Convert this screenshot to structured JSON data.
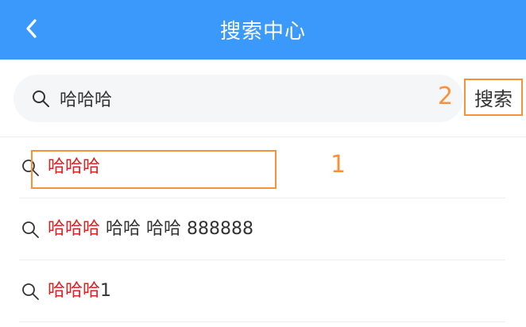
{
  "header": {
    "title": "搜索中心",
    "background_color": "#3a99fb",
    "back_icon": "chevron-left-icon"
  },
  "search": {
    "value": "哈哈哈",
    "icon": "search-icon",
    "button_label": "搜索"
  },
  "suggestions": [
    {
      "highlight": "哈哈哈",
      "rest": ""
    },
    {
      "highlight": "哈哈哈",
      "rest": " 哈哈 哈哈 888888"
    },
    {
      "highlight": "哈哈哈",
      "rest": "1"
    }
  ],
  "annotations": {
    "label_1": "1",
    "label_2": "2",
    "color": "#f7923a"
  },
  "colors": {
    "highlight": "#e02020",
    "text": "#333333"
  }
}
